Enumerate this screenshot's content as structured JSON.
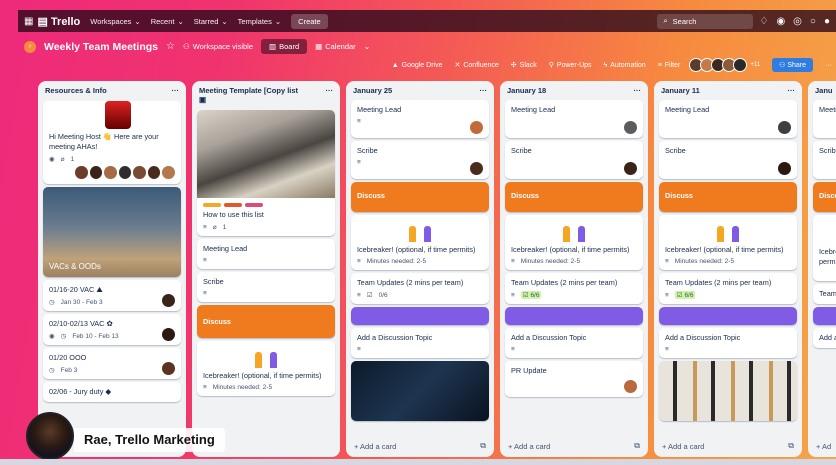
{
  "topbar": {
    "app": "Trello",
    "menus": [
      "Workspaces",
      "Recent",
      "Starred",
      "Templates"
    ],
    "create": "Create",
    "search": "Search"
  },
  "board": {
    "name": "Weekly Team Meetings",
    "visibility": "Workspace visible",
    "views": [
      "Board",
      "Calendar"
    ],
    "powerups": [
      "Google Drive",
      "Confluence",
      "Slack",
      "Power-Ups",
      "Automation",
      "Filter"
    ],
    "member_extra": "+11",
    "share": "Share"
  },
  "lists": [
    {
      "title": "Resources & Info",
      "cards": [
        {
          "text": "Hi Meeting Host 👋 Here are your meeting AHAs!",
          "meta": "1"
        },
        {
          "text": "VACs & OODs"
        },
        {
          "text": "01/16-20 VAC",
          "date": "Jan 30 - Feb 3"
        },
        {
          "text": "02/10-02/13 VAC",
          "date": "Feb 10 - Feb 13"
        },
        {
          "text": "01/20 OOO",
          "date": "Feb 3"
        },
        {
          "text": "02/06 - Jury duty"
        }
      ]
    },
    {
      "title": "Meeting Template [Copy list",
      "cards": [
        {
          "text": "How to use this list",
          "meta": "1"
        },
        {
          "text": "Meeting Lead"
        },
        {
          "text": "Scribe"
        },
        {
          "text": "Discuss"
        },
        {
          "text": "Icebreaker! (optional, if time permits)",
          "meta": "Minutes needed: 2-5"
        }
      ]
    },
    {
      "title": "January 25",
      "cards": [
        {
          "text": "Meeting Lead"
        },
        {
          "text": "Scribe"
        },
        {
          "text": "Discuss"
        },
        {
          "text": "Icebreaker! (optional, if time permits)",
          "meta": "Minutes needed: 2-5"
        },
        {
          "text": "Team Updates (2 mins per team)",
          "check": "0/6"
        },
        {
          "text": "Add a Discussion Topic"
        }
      ]
    },
    {
      "title": "January 18",
      "cards": [
        {
          "text": "Meeting Lead"
        },
        {
          "text": "Scribe"
        },
        {
          "text": "Discuss"
        },
        {
          "text": "Icebreaker! (optional, if time permits)",
          "meta": "Minutes needed: 2-5"
        },
        {
          "text": "Team Updates (2 mins per team)",
          "check": "6/6"
        },
        {
          "text": "Add a Discussion Topic"
        },
        {
          "text": "PR Update"
        }
      ]
    },
    {
      "title": "January 11",
      "cards": [
        {
          "text": "Meeting Lead"
        },
        {
          "text": "Scribe"
        },
        {
          "text": "Discuss"
        },
        {
          "text": "Icebreaker! (optional, if time permits)",
          "meta": "Minutes needed: 2-5"
        },
        {
          "text": "Team Updates (2 mins per team)",
          "check": "6/6"
        },
        {
          "text": "Add a Discussion Topic"
        }
      ]
    },
    {
      "title": "Janu",
      "cards": [
        {
          "text": "Meeti"
        },
        {
          "text": "Scribe"
        },
        {
          "text": "Discu"
        },
        {
          "text": "Icebre"
        },
        {
          "text": "permi"
        },
        {
          "text": "Team"
        },
        {
          "text": "Add a"
        }
      ]
    }
  ],
  "add_card": "+ Add a card",
  "add_card_short": "+ Ad",
  "presenter": "Rae, Trello Marketing",
  "colors": {
    "orange": "#f07a1e",
    "purple": "#7f5be6",
    "share": "#2f7de1"
  }
}
